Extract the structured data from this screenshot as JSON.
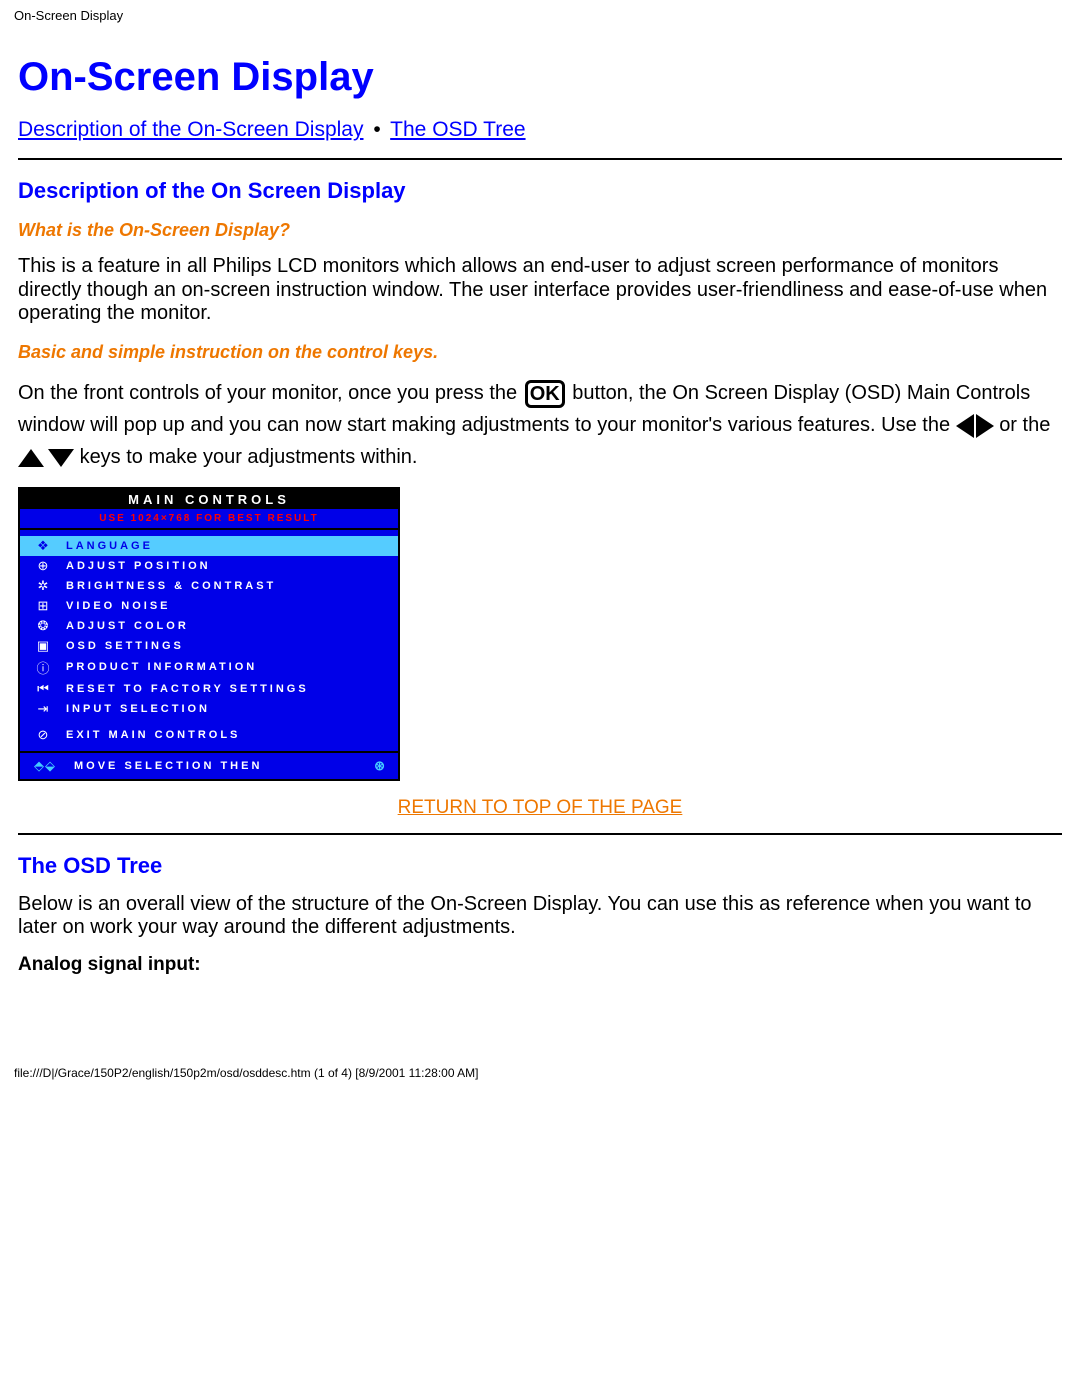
{
  "header": {
    "title": "On-Screen Display"
  },
  "page": {
    "h1": "On-Screen Display",
    "nav": {
      "link1": "Description of the On-Screen Display",
      "link2": "The OSD Tree"
    },
    "section1": {
      "heading": "Description of the On Screen Display",
      "sub1": "What is the On-Screen Display?",
      "para1": "This is a feature in all Philips LCD monitors which allows an end-user to adjust screen performance of monitors directly though an on-screen instruction window. The user interface provides user-friendliness and ease-of-use when operating the monitor.",
      "sub2": "Basic and simple instruction on the control keys.",
      "line_a": "On the front controls of your monitor, once you press the ",
      "ok_label": "OK",
      "line_b": " button, the On Screen Display (OSD) Main Controls window will pop up and you can now start making adjustments to your monitor's various features. Use the ",
      "line_mid": " or the ",
      "line_c": " keys to make your adjustments within."
    },
    "osd": {
      "title": "MAIN CONTROLS",
      "warn": "USE 1024×768 FOR BEST RESULT",
      "items": [
        {
          "icon": "❖",
          "label": "LANGUAGE",
          "selected": true
        },
        {
          "icon": "⊕",
          "label": "ADJUST POSITION"
        },
        {
          "icon": "✲",
          "label": "BRIGHTNESS & CONTRAST"
        },
        {
          "icon": "⊞",
          "label": "VIDEO NOISE"
        },
        {
          "icon": "❂",
          "label": "ADJUST COLOR"
        },
        {
          "icon": "▣",
          "label": "OSD SETTINGS"
        },
        {
          "icon": "ⓘ",
          "label": "PRODUCT INFORMATION"
        },
        {
          "icon": "⏮",
          "label": "RESET TO FACTORY SETTINGS"
        },
        {
          "icon": "⇥",
          "label": "INPUT SELECTION"
        },
        {
          "icon": "⊘",
          "label": "EXIT MAIN CONTROLS",
          "gap_before": true
        }
      ],
      "footer": {
        "icons": "⬘⬙",
        "label": "MOVE SELECTION THEN",
        "ok": "⊛"
      }
    },
    "return_link": "RETURN TO TOP OF THE PAGE",
    "section2": {
      "heading": "The OSD Tree",
      "para": "Below is an overall view of the structure of the On-Screen Display. You can use this as reference when you want to later on work your way around the different adjustments.",
      "subhead": "Analog signal input:"
    }
  },
  "footer": {
    "path": "file:///D|/Grace/150P2/english/150p2m/osd/osddesc.htm (1 of 4) [8/9/2001 11:28:00 AM]"
  }
}
